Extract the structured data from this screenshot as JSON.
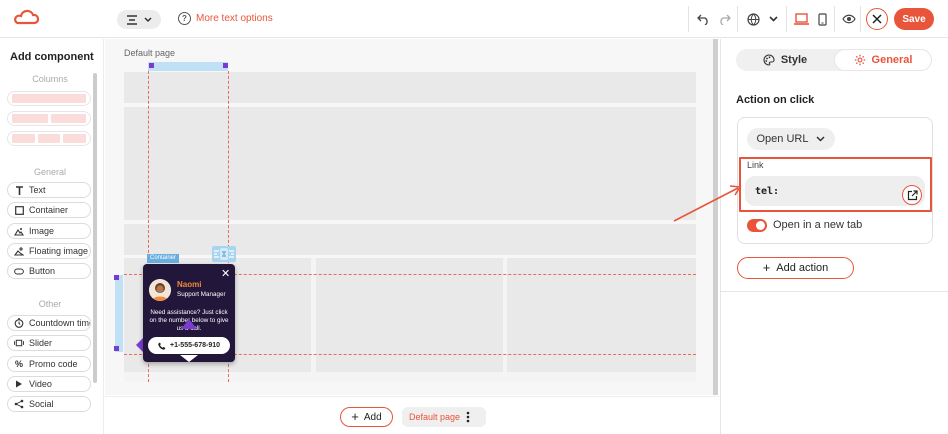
{
  "topbar": {
    "more_text_options": "More text options",
    "save_label": "Save",
    "icons": [
      "align-center-icon",
      "chevron-down-icon",
      "help-icon",
      "undo-icon",
      "redo-icon",
      "globe-icon",
      "chevron-down-icon",
      "desktop-icon",
      "mobile-icon",
      "preview-eye-icon",
      "close-icon"
    ]
  },
  "sidebar": {
    "title": "Add component",
    "columns_label": "Columns",
    "general_label": "General",
    "other_label": "Other",
    "general_items": [
      {
        "label": "Text",
        "icon": "text-icon"
      },
      {
        "label": "Container",
        "icon": "container-icon"
      },
      {
        "label": "Image",
        "icon": "image-icon"
      },
      {
        "label": "Floating image",
        "icon": "floating-image-icon"
      },
      {
        "label": "Button",
        "icon": "button-icon"
      }
    ],
    "other_items": [
      {
        "label": "Countdown timer",
        "icon": "timer-icon"
      },
      {
        "label": "Slider",
        "icon": "slider-icon"
      },
      {
        "label": "Promo code",
        "icon": "percent-icon"
      },
      {
        "label": "Video",
        "icon": "play-icon"
      },
      {
        "label": "Social",
        "icon": "share-icon"
      }
    ]
  },
  "canvas": {
    "page_label": "Default page",
    "container_tag": "Container",
    "widget": {
      "name": "Naomi",
      "role": "Support Manager",
      "message": "Need assistance? Just click on the number below to give us a call.",
      "phone": "+1-555-678-910"
    }
  },
  "bottom": {
    "add_label": "Add",
    "page_chip": "Default page"
  },
  "panel": {
    "tab_style": "Style",
    "tab_general": "General",
    "action_title": "Action on click",
    "action_type": "Open URL",
    "link_label": "Link",
    "link_value": "tel:",
    "open_new_tab": "Open in a new tab",
    "open_new_tab_enabled": true,
    "add_action": "Add action"
  },
  "colors": {
    "accent": "#e8553b",
    "widget_bg": "#22163a",
    "selection": "#7a3cd0"
  }
}
